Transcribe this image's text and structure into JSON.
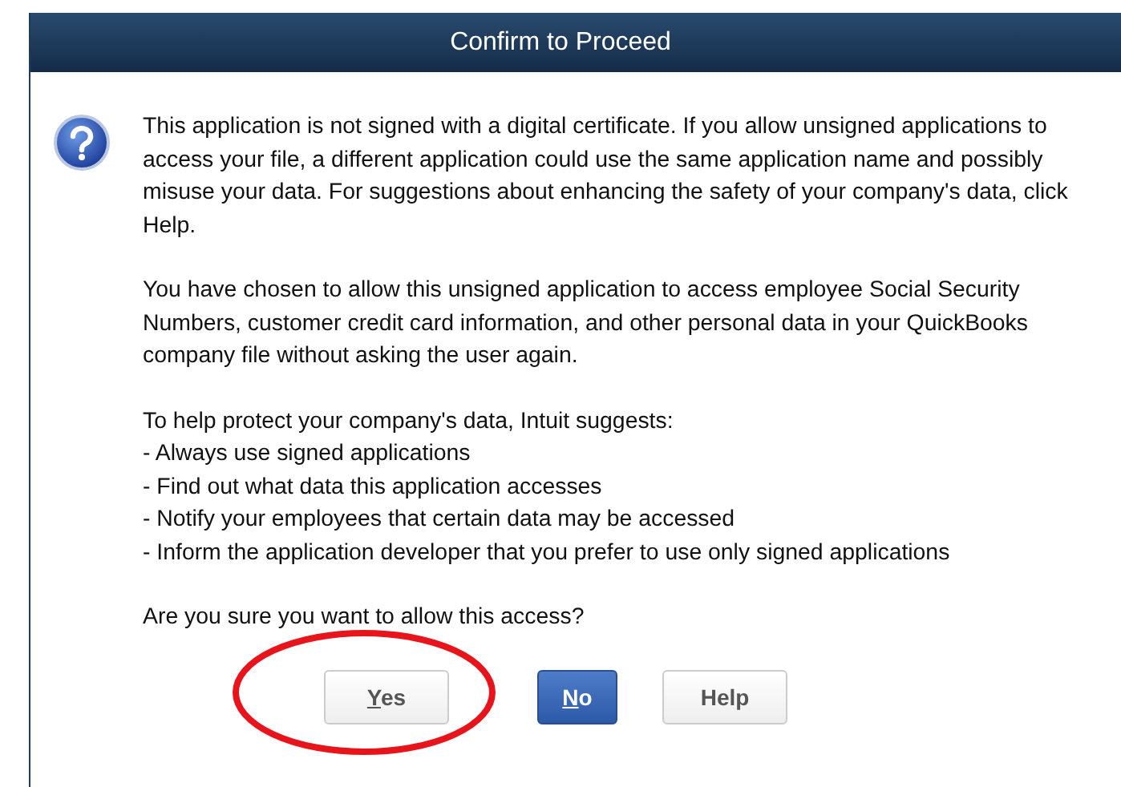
{
  "window": {
    "title": "Confirm to Proceed"
  },
  "paragraphs": [
    "This application is not signed with a digital certificate.  If you allow unsigned applications to access your file, a different application could use the same application name and possibly misuse your data.  For suggestions about enhancing the safety of your company's data, click Help.",
    "You have chosen to allow this unsigned application to access employee Social Security Numbers, customer credit card information, and other personal data in your QuickBooks company file without asking the user again."
  ],
  "suggestions": {
    "intro": "To help protect your company's data, Intuit suggests:",
    "items": [
      "- Always use signed applications",
      "- Find out what data this application accesses",
      "- Notify your employees that certain data may be accessed",
      "- Inform the application developer that you prefer to use only signed applications"
    ]
  },
  "question": "Are you sure you want to allow this access?",
  "buttons": [
    {
      "label": "Yes",
      "default": false,
      "mnemonic": true,
      "circled": true
    },
    {
      "label": "No",
      "default": true,
      "mnemonic": true,
      "circled": false
    },
    {
      "label": "Help",
      "default": false,
      "mnemonic": false,
      "circled": false
    }
  ]
}
